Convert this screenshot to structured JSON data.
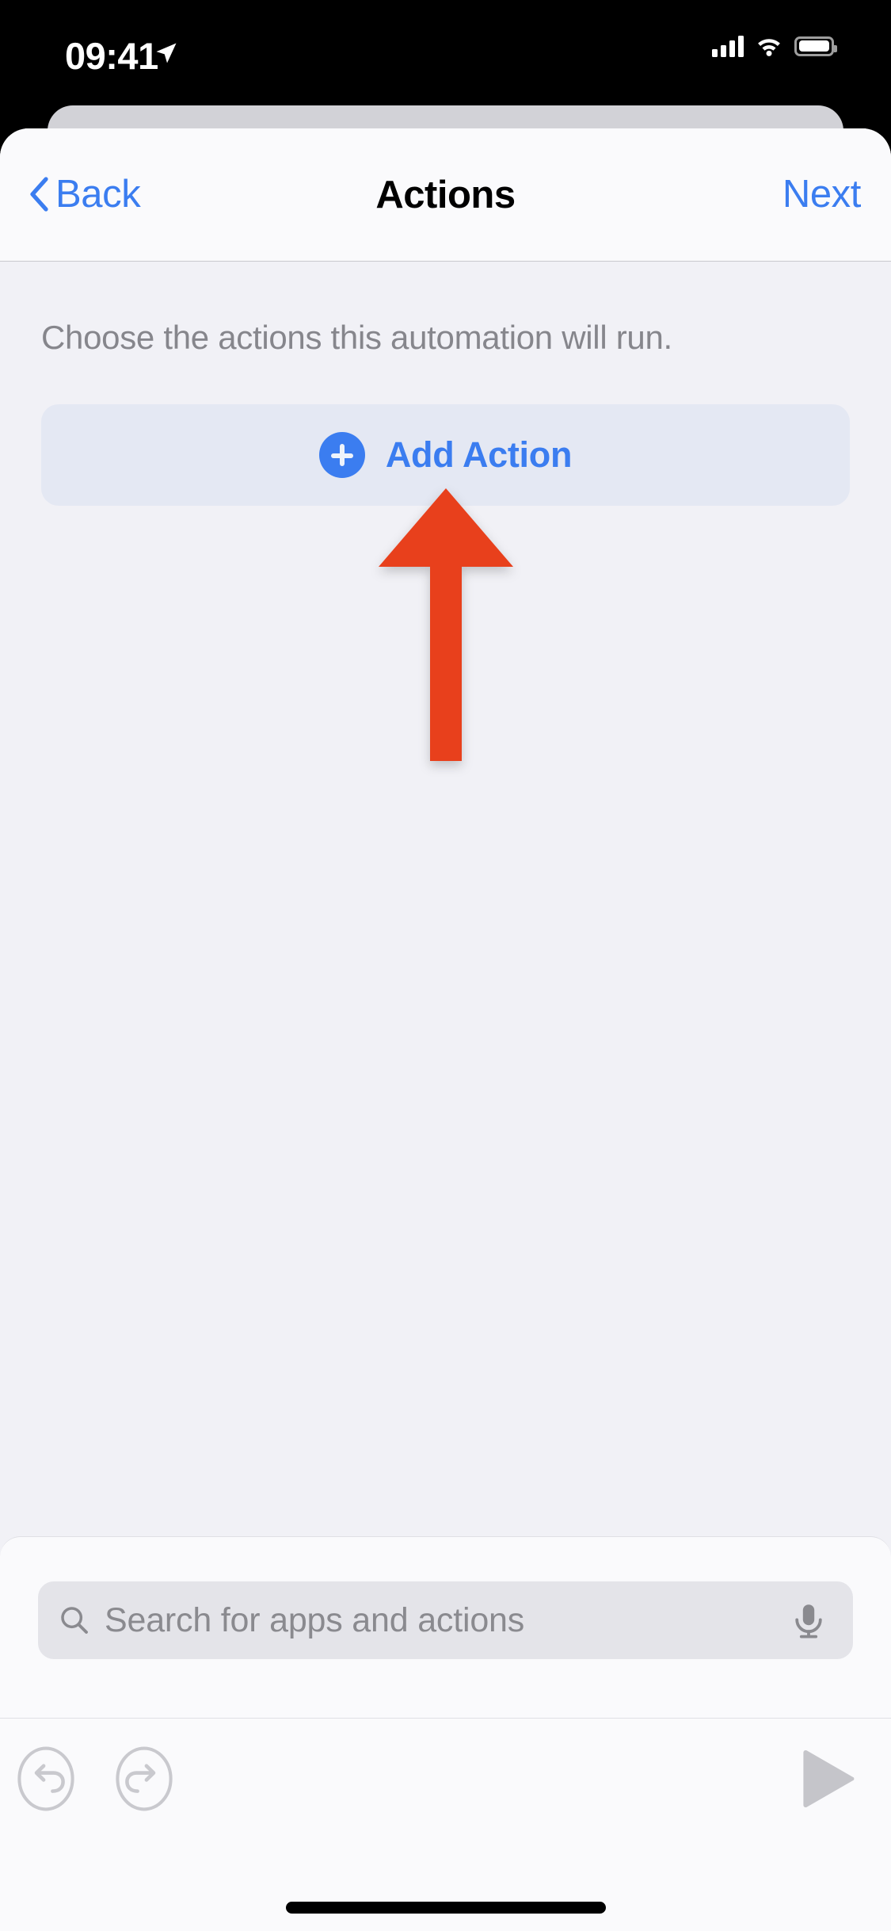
{
  "status_bar": {
    "time": "09:41",
    "location_icon": "location-arrow-icon",
    "cellular_icon": "cellular-signal-icon",
    "wifi_icon": "wifi-icon",
    "battery_icon": "battery-icon"
  },
  "nav": {
    "back_label": "Back",
    "back_icon": "chevron-left-icon",
    "title": "Actions",
    "next_label": "Next"
  },
  "content": {
    "subtitle": "Choose the actions this automation will run.",
    "add_action_label": "Add Action",
    "add_action_icon": "plus-circle-icon"
  },
  "annotation": {
    "type": "arrow-up",
    "color": "#e8401f",
    "points_to": "Add Action"
  },
  "search": {
    "placeholder": "Search for apps and actions",
    "value": "",
    "search_icon": "search-icon",
    "mic_icon": "microphone-icon"
  },
  "toolbar": {
    "undo_icon": "undo-icon",
    "redo_icon": "redo-icon",
    "play_icon": "play-icon"
  },
  "colors": {
    "accent_blue": "#3b7df0",
    "annotation_red": "#e8401f",
    "content_bg": "#f1f1f6",
    "sheet_bg": "#fafafc",
    "add_action_bg": "#e4e8f3",
    "search_field_bg": "#e4e4e9",
    "disabled_gray": "#c7c7cc"
  }
}
